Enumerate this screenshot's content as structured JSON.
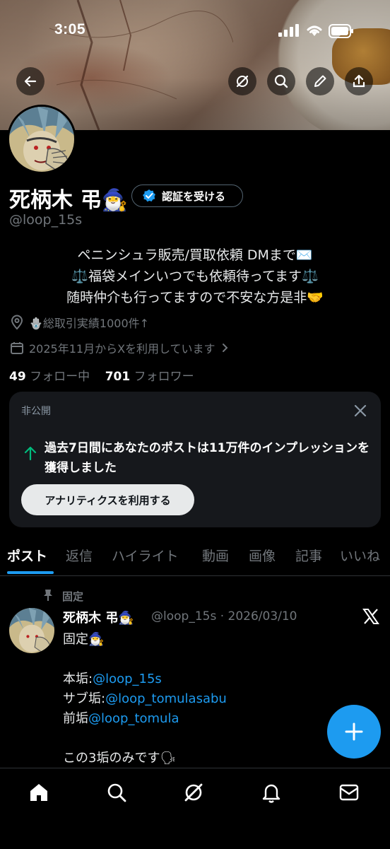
{
  "status_bar": {
    "time": "3:05"
  },
  "profile": {
    "display_name": "死柄木 弔🧙‍♂️",
    "verify_button": "認証を受ける",
    "handle": "@loop_15s",
    "bio_lines": [
      "ペニンシュラ販売/買取依頼 DMまで✉️",
      "⚖️福袋メインいつでも依頼待ってます⚖️",
      "随時仲介も行ってますので不安な方是非🤝"
    ],
    "location": "🪬総取引実績1000件↑",
    "joined": "2025年11月からXを利用しています",
    "following_count": "49",
    "following_label": "フォロー中",
    "followers_count": "701",
    "followers_label": "フォロワー"
  },
  "private_card": {
    "label": "非公開",
    "text": "過去7日間にあなたのポストは11万件のインプレッションを獲得しました",
    "button": "アナリティクスを利用する"
  },
  "tabs": [
    {
      "label": "ポスト",
      "active": true
    },
    {
      "label": "返信"
    },
    {
      "label": "ハイライト"
    },
    {
      "label": "動画"
    },
    {
      "label": "画像"
    },
    {
      "label": "記事"
    },
    {
      "label": "いいね"
    }
  ],
  "post": {
    "pinned_label": "固定",
    "author_name": "死柄木 弔🧙‍♂️",
    "author_meta": "@loop_15s · 2026/03/10",
    "line1": "固定🧙‍♂️",
    "line2_prefix": "本垢:",
    "line2_mention": "@loop_15s",
    "line3_prefix": "サブ垢:",
    "line3_mention": "@loop_tomulasabu",
    "line4_prefix": "前垢",
    "line4_mention": "@loop_tomula",
    "line5": "この3垢のみです🗣"
  },
  "colors": {
    "accent": "#1d9bf0",
    "background": "#000000",
    "card": "#16181c",
    "muted": "#71767b"
  },
  "icons": [
    "back-arrow-icon",
    "grok-icon",
    "search-icon",
    "edit-icon",
    "share-icon",
    "verified-badge-icon",
    "location-pin-icon",
    "calendar-icon",
    "chevron-right-icon",
    "close-icon",
    "arrow-up-icon",
    "pin-icon",
    "x-logo-icon",
    "plus-icon",
    "home-icon",
    "notifications-icon",
    "messages-icon"
  ]
}
